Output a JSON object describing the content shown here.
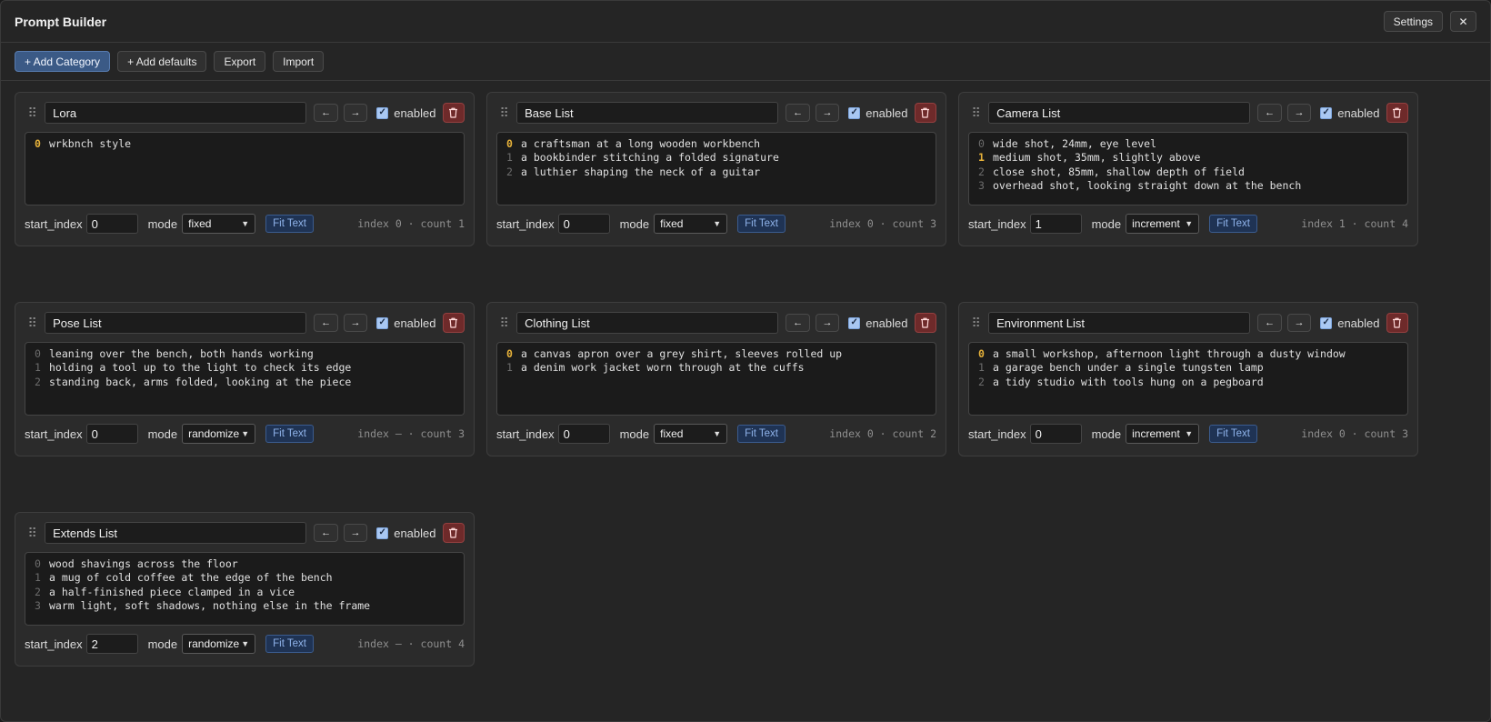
{
  "app": {
    "title": "Prompt Builder",
    "settings_label": "Settings",
    "close_label": "✕"
  },
  "toolbar": {
    "add_category": "+ Add Category",
    "add_defaults": "+ Add defaults",
    "export": "Export",
    "import": "Import"
  },
  "labels": {
    "enabled": "enabled",
    "start_index": "start_index",
    "mode": "mode",
    "fit_text": "Fit Text",
    "left_arrow": "←",
    "right_arrow": "→",
    "drag_handle": "⠿"
  },
  "categories": [
    {
      "name": "Lora",
      "enabled": true,
      "active_index": 0,
      "items": [
        "wrkbnch style"
      ],
      "start_index": "0",
      "mode": "fixed",
      "status": "index 0 · count 1"
    },
    {
      "name": "Base List",
      "enabled": true,
      "active_index": 0,
      "items": [
        "a craftsman at a long wooden workbench",
        "a bookbinder stitching a folded signature",
        "a luthier shaping the neck of a guitar"
      ],
      "start_index": "0",
      "mode": "fixed",
      "status": "index 0 · count 3"
    },
    {
      "name": "Camera List",
      "enabled": true,
      "active_index": 1,
      "items": [
        "wide shot, 24mm, eye level",
        "medium shot, 35mm, slightly above",
        "close shot, 85mm, shallow depth of field",
        "overhead shot, looking straight down at the bench"
      ],
      "start_index": "1",
      "mode": "increment",
      "status": "index 1 · count 4"
    },
    {
      "name": "Pose List",
      "enabled": true,
      "active_index": null,
      "items": [
        "leaning over the bench, both hands working",
        "holding a tool up to the light to check its edge",
        "standing back, arms folded, looking at the piece"
      ],
      "start_index": "0",
      "mode": "randomize",
      "status": "index – · count 3"
    },
    {
      "name": "Clothing List",
      "enabled": true,
      "active_index": 0,
      "items": [
        "a canvas apron over a grey shirt, sleeves rolled up",
        "a denim work jacket worn through at the cuffs"
      ],
      "start_index": "0",
      "mode": "fixed",
      "status": "index 0 · count 2"
    },
    {
      "name": "Environment List",
      "enabled": true,
      "active_index": 0,
      "items": [
        "a small workshop, afternoon light through a dusty window",
        "a garage bench under a single tungsten lamp",
        "a tidy studio with tools hung on a pegboard"
      ],
      "start_index": "0",
      "mode": "increment",
      "status": "index 0 · count 3"
    },
    {
      "name": "Extends List",
      "enabled": true,
      "active_index": null,
      "items": [
        "wood shavings across the floor",
        "a mug of cold coffee at the edge of the bench",
        "a half-finished piece clamped in a vice",
        "warm light, soft shadows, nothing else in the frame"
      ],
      "start_index": "2",
      "mode": "randomize",
      "status": "index – · count 4"
    }
  ]
}
